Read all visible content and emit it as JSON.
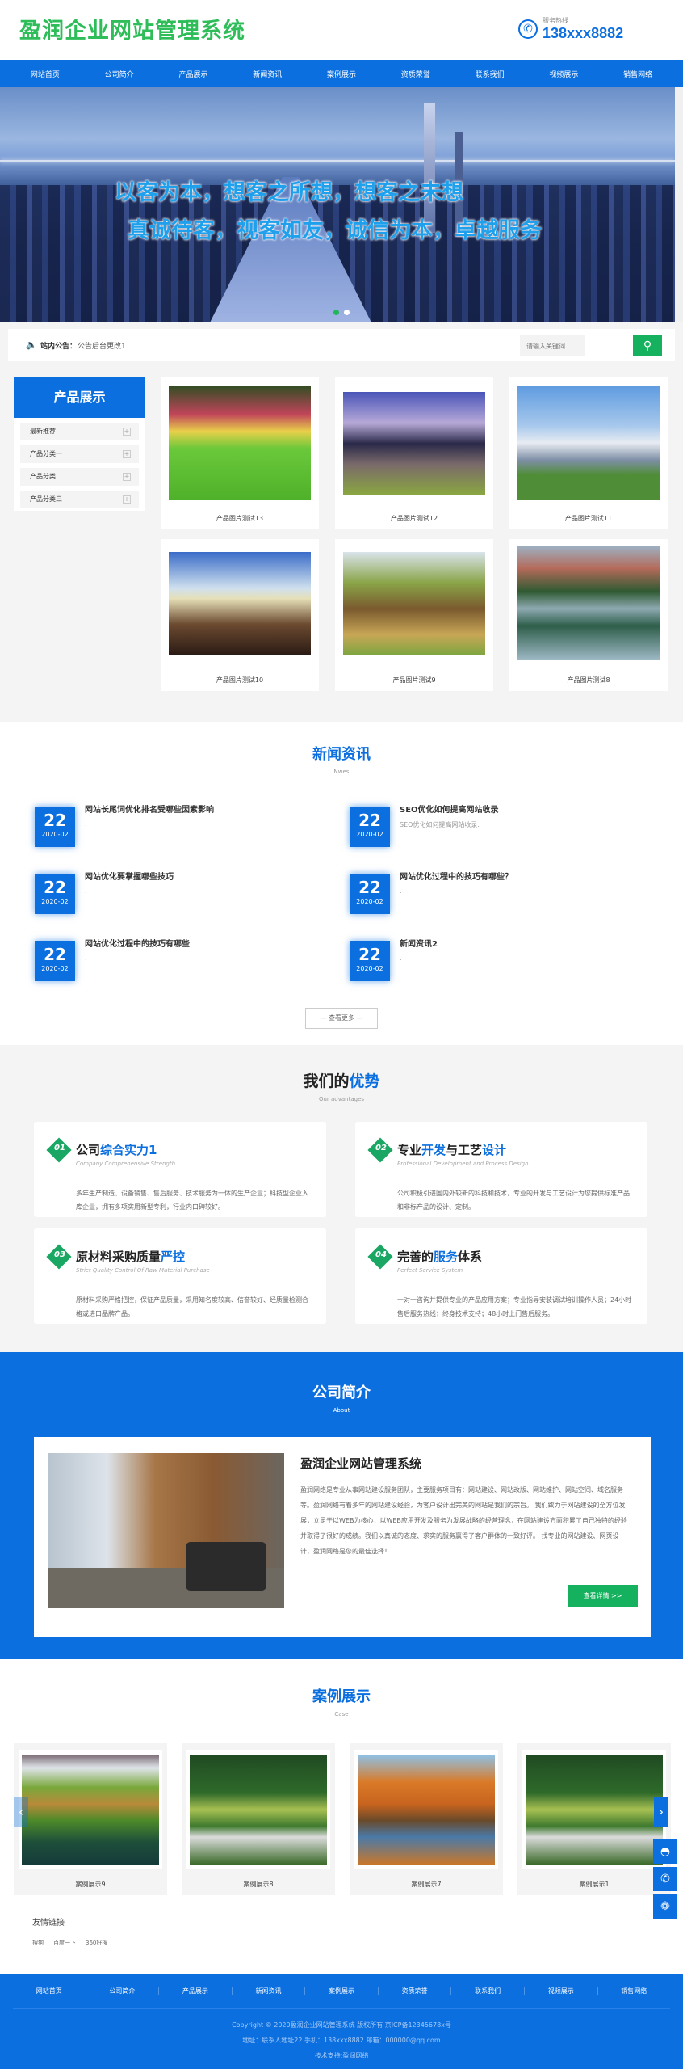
{
  "header": {
    "site_title": "盈润企业网站管理系统",
    "hotline_label": "服务热线",
    "hotline_number": "138xxx8882",
    "phone_icon": "phone-icon"
  },
  "nav": {
    "items": [
      "网站首页",
      "公司简介",
      "产品展示",
      "新闻资讯",
      "案例展示",
      "资质荣誉",
      "联系我们",
      "视频展示",
      "销售网络"
    ]
  },
  "banner": {
    "slogan_line1": "以客为本，想客之所想，想客之未想",
    "slogan_line2": "真诚待客，视客如友，诚信为本，卓越服务",
    "slide_count": 2,
    "active_slide": 1
  },
  "notice": {
    "icon": "speaker-icon",
    "label": "站内公告：",
    "text": "公告后台更改1",
    "search_placeholder": "请输入关键词",
    "search_icon": "search-icon"
  },
  "products": {
    "sidebar_title": "产品展示",
    "categories": [
      "最新推荐",
      "产品分类一",
      "产品分类二",
      "产品分类三"
    ],
    "items": [
      "产品图片测试13",
      "产品图片测试12",
      "产品图片测试11",
      "产品图片测试10",
      "产品图片测试9",
      "产品图片测试8"
    ]
  },
  "news": {
    "title": "新闻资讯",
    "subtitle": "Nwes",
    "items": [
      {
        "day": "22",
        "ym": "2020-02",
        "title": "网站长尾词优化排名受哪些因素影响",
        "desc": "."
      },
      {
        "day": "22",
        "ym": "2020-02",
        "title": "SEO优化如何提高网站收录",
        "desc": "SEO优化如何提高网站收录."
      },
      {
        "day": "22",
        "ym": "2020-02",
        "title": "网站优化要掌握哪些技巧",
        "desc": "."
      },
      {
        "day": "22",
        "ym": "2020-02",
        "title": "网站优化过程中的技巧有哪些？",
        "desc": "."
      },
      {
        "day": "22",
        "ym": "2020-02",
        "title": "网站优化过程中的技巧有哪些",
        "desc": "."
      },
      {
        "day": "22",
        "ym": "2020-02",
        "title": "新闻资讯2",
        "desc": "."
      }
    ],
    "more_label": "— 查看更多 —"
  },
  "advantages": {
    "title_black": "我们的",
    "title_blue": "优势",
    "subtitle": "Our advantages",
    "items": [
      {
        "num": "01",
        "t_black": "公司",
        "t_blue": "综合实力1",
        "t_tail": "",
        "en": "Company Comprehensive Strength",
        "desc": "多年生产制造、设备销售、售后服务、技术服务为一体的生产企业；科技型企业入库企业，拥有多项实用新型专利，行业内口碑较好。"
      },
      {
        "num": "02",
        "t_black": "专业",
        "t_blue": "开发",
        "t_mid": "与工艺",
        "t_blue2": "设计",
        "en": "Professional Development and Process Design",
        "desc": "公司积极引进国内外较新的科技和技术，专业的开发与工艺设计为您提供标准产品和非标产品的设计、定制。"
      },
      {
        "num": "03",
        "t_black": "原材料采购质量",
        "t_blue": "严控",
        "t_tail": "",
        "en": "Strict Quality Control Of Raw Material Purchase",
        "desc": "原材料采购严格把控，保证产品质量，采用知名度较高、信誉较好、经质量检测合格或进口品牌产品。"
      },
      {
        "num": "04",
        "t_black": "完善的",
        "t_blue": "服务",
        "t_tail": "体系",
        "en": "Perfect Service System",
        "desc": "一对一咨询并提供专业的产品应用方案；专业指导安装调试培训操作人员；24小时售后服务热线；终身技术支持；48小时上门售后服务。"
      }
    ]
  },
  "about": {
    "title": "公司简介",
    "subtitle": "About",
    "heading": "盈润企业网站管理系统",
    "text": "盈润网络是专业从事网站建设服务团队，主要服务项目有：网站建设、网站改版、网站维护、网站空间、域名服务等。盈润网络有着多年的网站建设经验，为客户设计出完美的网站是我们的宗旨。 我们致力于网站建设的全方位发展，立足于以WEB为核心，以WEB应用开发及服务为发展战略的经营理念，在网站建设方面积累了自己独特的经验并取得了很好的成绩。我们以真诚的态度、求实的服务赢得了客户群体的一致好评。 找专业的网站建设、网页设计，盈润网络是您的最佳选择！.....",
    "button": "查看详情 >>"
  },
  "cases": {
    "title": "案例展示",
    "subtitle": "Case",
    "items": [
      "案例展示9",
      "案例展示8",
      "案例展示7",
      "案例展示1"
    ],
    "prev_icon": "chevron-left-icon",
    "next_icon": "chevron-right-icon"
  },
  "float_bar": {
    "items": [
      "qq-icon",
      "phone-icon",
      "wechat-icon"
    ]
  },
  "links": {
    "title": "友情链接",
    "items": [
      "搜狗",
      "百度一下",
      "360好搜"
    ]
  },
  "footer": {
    "nav": [
      "网站首页",
      "公司简介",
      "产品展示",
      "新闻资讯",
      "案例展示",
      "资质荣誉",
      "联系我们",
      "视频展示",
      "销售网络"
    ],
    "copyright": "Copyright © 2020盈润企业网站管理系统 版权所有  京ICP备12345678x号",
    "contact": "地址：联系人地址22 手机：138xxx8882 邮箱：000000@qq.com",
    "support": "技术支持:盈润网络"
  },
  "colors": {
    "brand_blue": "#0b6fe0",
    "brand_green": "#15b15e",
    "logo_green": "#2ebd59"
  }
}
